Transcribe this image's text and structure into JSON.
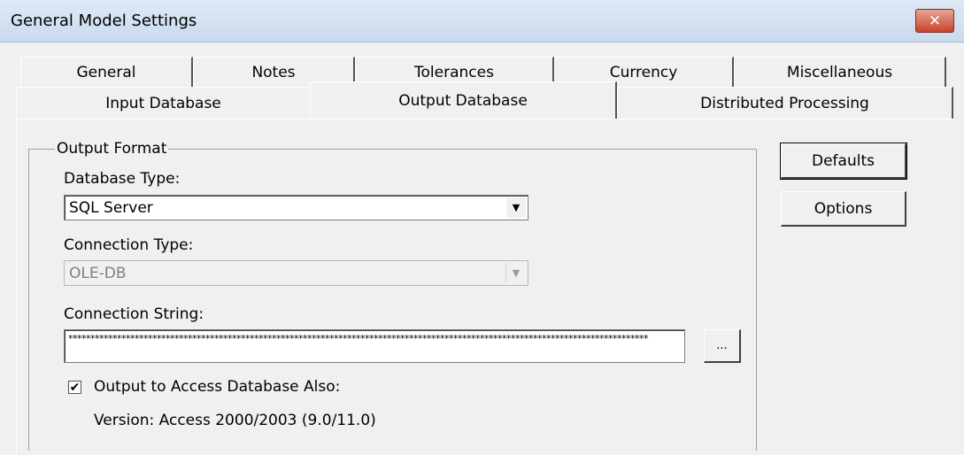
{
  "window": {
    "title": "General Model Settings",
    "close_icon": "✕"
  },
  "tabs_row1": [
    {
      "label": "General"
    },
    {
      "label": "Notes"
    },
    {
      "label": "Tolerances"
    },
    {
      "label": "Currency"
    },
    {
      "label": "Miscellaneous"
    }
  ],
  "tabs_row2": [
    {
      "label": "Input Database"
    },
    {
      "label": "Output Database",
      "active": true
    },
    {
      "label": "Distributed Processing"
    }
  ],
  "output_format": {
    "legend": "Output Format",
    "database_type": {
      "label": "Database Type:",
      "value": "SQL Server"
    },
    "connection_type": {
      "label": "Connection Type:",
      "value": "OLE-DB",
      "disabled": true
    },
    "connection_string": {
      "label": "Connection String:",
      "value": "***********************************************************************************************************************************",
      "browse_label": "..."
    },
    "access_checkbox": {
      "label": "Output to Access Database Also:",
      "checked": true
    },
    "version_text": "Version: Access 2000/2003 (9.0/11.0)"
  },
  "buttons": {
    "defaults": "Defaults",
    "options": "Options"
  }
}
